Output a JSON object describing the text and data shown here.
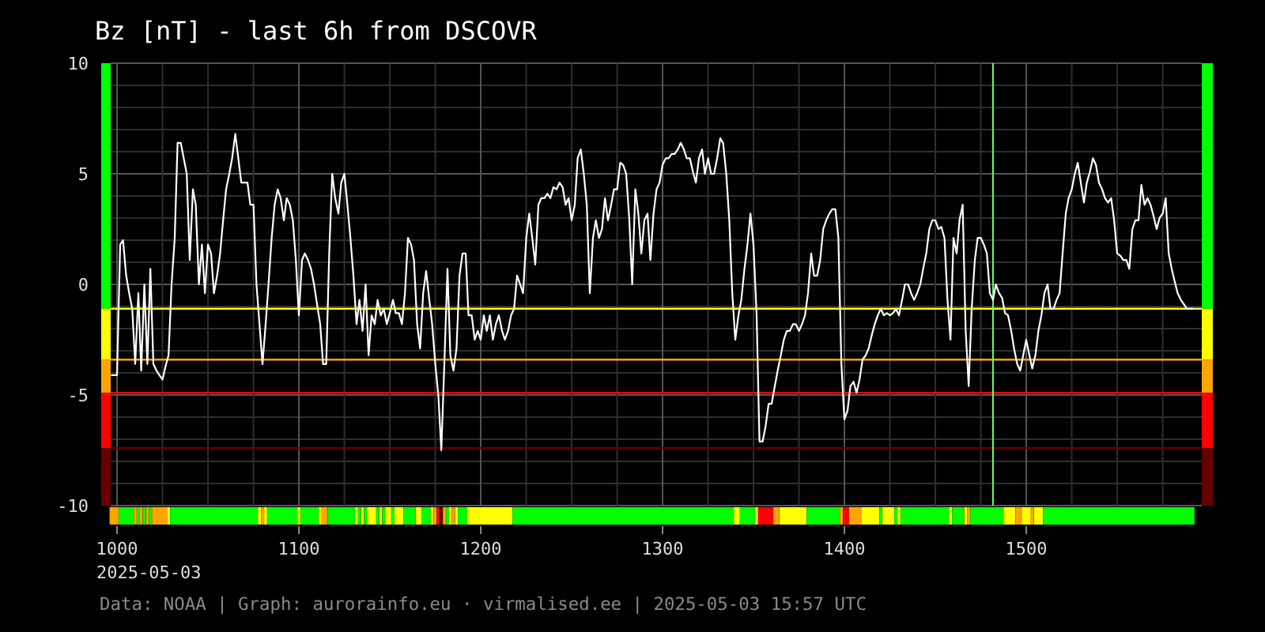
{
  "chart": {
    "chart_data": {
      "type": "line",
      "title": "Bz [nT] - last 6h from DSCOVR",
      "xlim": [
        996.5,
        1596.5
      ],
      "ylim": [
        -10,
        10
      ],
      "xticks": [
        1000,
        1100,
        1200,
        1300,
        1400,
        1500
      ],
      "yticks": [
        -10,
        -5,
        0,
        5,
        10
      ],
      "x": [
        996.7,
        998.3,
        1000,
        1001.7,
        1003.3,
        1005,
        1006.7,
        1008.3,
        1010,
        1011.7,
        1013.3,
        1015,
        1016.7,
        1018.3,
        1020,
        1021.7,
        1023.3,
        1025,
        1026.7,
        1028.3,
        1030,
        1031.7,
        1033.3,
        1035,
        1036.7,
        1038.3,
        1040,
        1041.7,
        1043.3,
        1045,
        1046.7,
        1048.3,
        1050,
        1051.7,
        1053.3,
        1055,
        1056.7,
        1058.3,
        1060,
        1061.7,
        1063.3,
        1065,
        1066.7,
        1068.3,
        1070,
        1071.7,
        1073.3,
        1075,
        1076.7,
        1078.3,
        1080,
        1081.7,
        1083.3,
        1085,
        1086.7,
        1088.3,
        1090,
        1091.7,
        1093.3,
        1095,
        1096.7,
        1098.3,
        1100,
        1101.7,
        1103.3,
        1105,
        1106.7,
        1108.3,
        1110,
        1111.7,
        1113.3,
        1115,
        1116.7,
        1118.3,
        1120,
        1121.7,
        1123.3,
        1125,
        1126.7,
        1128.3,
        1130,
        1131.7,
        1133.3,
        1135,
        1136.7,
        1138.3,
        1140,
        1141.7,
        1143.3,
        1145,
        1146.7,
        1148.3,
        1150,
        1151.7,
        1153.3,
        1155,
        1156.7,
        1158.3,
        1160,
        1161.7,
        1163.3,
        1165,
        1166.7,
        1168.3,
        1170,
        1171.7,
        1173.3,
        1175,
        1176.7,
        1178.3,
        1180,
        1181.7,
        1183.3,
        1185,
        1186.7,
        1188.3,
        1190,
        1191.7,
        1193.3,
        1195,
        1196.7,
        1198.3,
        1200,
        1201.7,
        1203.3,
        1205,
        1206.7,
        1208.3,
        1210,
        1211.7,
        1213.3,
        1215,
        1216.7,
        1218.3,
        1220,
        1221.7,
        1223.3,
        1225,
        1226.7,
        1228.3,
        1230,
        1231.7,
        1233.3,
        1235,
        1236.7,
        1238.3,
        1240,
        1241.7,
        1243.3,
        1245,
        1246.7,
        1248.3,
        1250,
        1251.7,
        1253.3,
        1255,
        1256.7,
        1258.3,
        1260,
        1261.7,
        1263.3,
        1265,
        1266.7,
        1268.3,
        1270,
        1271.7,
        1273.3,
        1275,
        1276.7,
        1278.3,
        1280,
        1281.7,
        1283.3,
        1285,
        1286.7,
        1288.3,
        1290,
        1291.7,
        1293.3,
        1295,
        1296.7,
        1298.3,
        1300,
        1301.7,
        1303.3,
        1305,
        1306.7,
        1308.3,
        1310,
        1311.7,
        1313.3,
        1315,
        1316.7,
        1318.3,
        1320,
        1321.7,
        1323.3,
        1325,
        1326.7,
        1328.3,
        1330,
        1331.7,
        1333.3,
        1335,
        1336.7,
        1338.3,
        1340,
        1341.7,
        1343.3,
        1345,
        1346.7,
        1348.3,
        1350,
        1351.7,
        1353.3,
        1355,
        1356.7,
        1358.3,
        1360,
        1361.7,
        1363.3,
        1365,
        1366.7,
        1368.3,
        1370,
        1371.7,
        1373.3,
        1375,
        1376.7,
        1378.3,
        1380,
        1381.7,
        1383.3,
        1385,
        1386.7,
        1388.3,
        1390,
        1391.7,
        1393.3,
        1395,
        1396.7,
        1398.3,
        1400,
        1401.7,
        1403.3,
        1405,
        1406.7,
        1408.3,
        1410,
        1411.7,
        1413.3,
        1415,
        1416.7,
        1418.3,
        1420,
        1421.7,
        1423.3,
        1425,
        1426.7,
        1428.3,
        1430,
        1431.7,
        1433.3,
        1435,
        1436.7,
        1438.3,
        1440,
        1441.7,
        1443.3,
        1445,
        1446.7,
        1448.3,
        1450,
        1451.7,
        1453.3,
        1455,
        1456.7,
        1458.3,
        1460,
        1461.7,
        1463.3,
        1465,
        1466.7,
        1468.3,
        1470,
        1471.7,
        1473.3,
        1475,
        1476.7,
        1478.3,
        1480,
        1481.7,
        1483.3,
        1485,
        1486.7,
        1488.3,
        1490,
        1491.7,
        1493.3,
        1495,
        1496.7,
        1498.3,
        1500,
        1501.7,
        1503.3,
        1505,
        1506.7,
        1508.3,
        1510,
        1511.7,
        1513.3,
        1515,
        1516.7,
        1518.3,
        1520,
        1521.7,
        1523.3,
        1525,
        1526.7,
        1528.3,
        1530,
        1531.7,
        1533.3,
        1535,
        1536.7,
        1538.3,
        1540,
        1541.7,
        1543.3,
        1545,
        1546.7,
        1548.3,
        1550,
        1551.7,
        1553.3,
        1555,
        1556.7,
        1558.3,
        1560,
        1561.7,
        1563.3,
        1565,
        1566.7,
        1568.3,
        1570,
        1571.7,
        1573.3,
        1575,
        1576.7,
        1578.3,
        1580,
        1581.7,
        1583.3,
        1585,
        1586.7,
        1588.3,
        1590,
        1591.7
      ],
      "series": [
        {
          "color": "#ffffff",
          "values": [
            -4.1,
            -4.1,
            -4.1,
            1.8,
            2.0,
            0.4,
            -0.4,
            -1.1,
            -3.6,
            -0.4,
            -3.9,
            0,
            -3.6,
            0.7,
            -3.6,
            -3.9,
            -4.1,
            -4.3,
            -3.7,
            -3.2,
            0,
            2.1,
            6.4,
            6.4,
            5.7,
            5.0,
            1.1,
            4.3,
            3.6,
            0,
            1.8,
            -0.4,
            1.8,
            1.4,
            -0.4,
            0.4,
            1.4,
            2.9,
            4.3,
            5.0,
            5.7,
            6.8,
            5.7,
            4.6,
            4.6,
            4.6,
            3.6,
            3.6,
            0,
            -1.8,
            -3.6,
            -1.8,
            0,
            2.1,
            3.6,
            4.3,
            3.9,
            2.9,
            3.9,
            3.6,
            2.9,
            1.1,
            -1.4,
            1.1,
            1.4,
            1.1,
            0.7,
            0,
            -0.9,
            -1.8,
            -3.6,
            -3.6,
            1.4,
            5.0,
            3.9,
            3.2,
            4.6,
            5.0,
            3.6,
            2.1,
            0.4,
            -1.8,
            -0.7,
            -2.1,
            0,
            -3.2,
            -1.4,
            -1.8,
            -0.7,
            -1.4,
            -1.1,
            -1.8,
            -1.3,
            -0.7,
            -1.3,
            -1.3,
            -1.8,
            -0.4,
            2.1,
            1.8,
            1.1,
            -1.8,
            -2.9,
            -0.4,
            0.6,
            -0.7,
            -1.8,
            -3.6,
            -5.0,
            -7.5,
            -3.6,
            0.7,
            -3.2,
            -3.9,
            -2.9,
            0.4,
            1.4,
            1.4,
            -1.4,
            -1.4,
            -2.5,
            -2.1,
            -2.5,
            -1.4,
            -2.1,
            -1.4,
            -2.5,
            -1.8,
            -1.4,
            -2.1,
            -2.5,
            -2.1,
            -1.4,
            -1.1,
            0.4,
            0,
            -0.4,
            2.1,
            3.2,
            2.1,
            0.9,
            3.6,
            3.9,
            3.9,
            4.1,
            3.9,
            4.4,
            4.3,
            4.6,
            4.4,
            3.6,
            3.9,
            2.9,
            3.6,
            5.7,
            6.1,
            5.0,
            3.6,
            -0.4,
            2.1,
            2.9,
            2.1,
            2.5,
            3.9,
            2.9,
            3.6,
            4.3,
            4.3,
            5.5,
            5.4,
            5.0,
            2.9,
            0,
            4.3,
            3.2,
            1.4,
            2.9,
            3.2,
            1.1,
            3.2,
            4.3,
            4.6,
            5.4,
            5.7,
            5.7,
            5.9,
            5.9,
            6.1,
            6.4,
            6.1,
            5.7,
            5.7,
            5.1,
            4.6,
            5.7,
            6.1,
            5.0,
            5.7,
            5.0,
            5.0,
            5.7,
            6.6,
            6.4,
            5.0,
            2.9,
            -0.4,
            -2.5,
            -1.4,
            -0.7,
            0.7,
            1.8,
            3.2,
            1.8,
            -1.4,
            -7.1,
            -7.1,
            -6.4,
            -5.4,
            -5.4,
            -4.6,
            -3.9,
            -3.2,
            -2.5,
            -2.1,
            -2.1,
            -1.8,
            -1.8,
            -2.1,
            -1.8,
            -1.4,
            -0.4,
            1.4,
            0.4,
            0.4,
            1.1,
            2.5,
            2.9,
            3.2,
            3.4,
            3.4,
            2.1,
            -3.6,
            -6.1,
            -5.7,
            -4.6,
            -4.4,
            -4.9,
            -4.3,
            -3.4,
            -3.2,
            -2.9,
            -2.3,
            -1.8,
            -1.4,
            -1.1,
            -1.4,
            -1.3,
            -1.4,
            -1.3,
            -1.1,
            -1.4,
            -0.7,
            0,
            0,
            -0.4,
            -0.7,
            -0.4,
            0,
            0.7,
            1.4,
            2.5,
            2.9,
            2.9,
            2.5,
            2.6,
            2.1,
            -0.7,
            -2.5,
            2.1,
            1.4,
            2.9,
            3.6,
            -2.1,
            -4.6,
            -1.1,
            1.1,
            2.1,
            2.1,
            1.8,
            1.4,
            -0.4,
            -0.7,
            0,
            -0.4,
            -0.6,
            -1.3,
            -1.4,
            -2.1,
            -2.9,
            -3.6,
            -3.9,
            -3.2,
            -2.5,
            -3.2,
            -3.8,
            -3.2,
            -2.1,
            -1.4,
            -0.4,
            0,
            -1.1,
            -1.1,
            -0.7,
            -0.4,
            1.4,
            3.2,
            3.9,
            4.3,
            5.0,
            5.5,
            4.6,
            3.7,
            4.6,
            5.1,
            5.7,
            5.4,
            4.6,
            4.3,
            3.9,
            3.7,
            3.9,
            2.9,
            1.4,
            1.3,
            1.1,
            1.1,
            0.7,
            2.5,
            2.9,
            2.9,
            4.5,
            3.6,
            3.9,
            3.6,
            3.1,
            2.5,
            3.0,
            3.2,
            3.9,
            1.4,
            0.7,
            0.1,
            -0.4,
            -0.7,
            -0.9,
            -1.1,
            -1.1,
            -1.1
          ]
        }
      ],
      "grid": true,
      "ref_lines": [
        {
          "axis": "y",
          "value": -1.1,
          "color": "#ffff00"
        },
        {
          "axis": "y",
          "value": -3.4,
          "color": "#ffa500"
        },
        {
          "axis": "y",
          "value": -4.9,
          "color": "#ff0000"
        },
        {
          "axis": "y",
          "value": -7.4,
          "color": "#660000"
        },
        {
          "axis": "x",
          "value": 1481.7,
          "color": "#66ff66"
        }
      ]
    },
    "severity_scale": [
      {
        "color": "#00ff00"
      },
      {
        "color": "#ffff00"
      },
      {
        "color": "#ffa500"
      },
      {
        "color": "#ff0000"
      },
      {
        "color": "#660000"
      }
    ]
  },
  "date_label": "2025-05-03",
  "footer": "Data: NOAA | Graph: aurorainfo.eu · virmalised.ee | 2025-05-03 15:57 UTC"
}
